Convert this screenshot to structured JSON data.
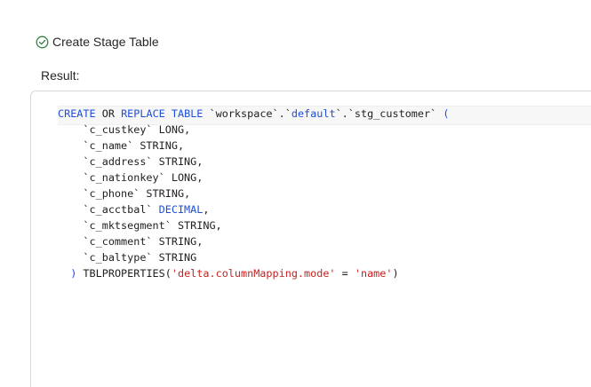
{
  "task": {
    "status_icon": "check-circle-icon",
    "title": "Create Stage Table",
    "status_color": "#2e8540"
  },
  "result": {
    "label": "Result:"
  },
  "code": {
    "lines": [
      [
        {
          "t": "CREATE",
          "c": "kw"
        },
        {
          "t": " ",
          "c": "plain"
        },
        {
          "t": "OR",
          "c": "plain"
        },
        {
          "t": " ",
          "c": "plain"
        },
        {
          "t": "REPLACE",
          "c": "kw"
        },
        {
          "t": " ",
          "c": "plain"
        },
        {
          "t": "TABLE",
          "c": "kw"
        },
        {
          "t": " `workspace`.`",
          "c": "plain"
        },
        {
          "t": "default",
          "c": "kw"
        },
        {
          "t": "`.`stg_customer` ",
          "c": "plain"
        },
        {
          "t": "(",
          "c": "kw"
        }
      ],
      [
        {
          "t": "    `c_custkey` LONG,",
          "c": "plain"
        }
      ],
      [
        {
          "t": "    `c_name` STRING,",
          "c": "plain"
        }
      ],
      [
        {
          "t": "    `c_address` STRING,",
          "c": "plain"
        }
      ],
      [
        {
          "t": "    `c_nationkey` LONG,",
          "c": "plain"
        }
      ],
      [
        {
          "t": "    `c_phone` STRING,",
          "c": "plain"
        }
      ],
      [
        {
          "t": "    `c_acctbal` ",
          "c": "plain"
        },
        {
          "t": "DECIMAL",
          "c": "kw"
        },
        {
          "t": ",",
          "c": "plain"
        }
      ],
      [
        {
          "t": "    `c_mktsegment` STRING,",
          "c": "plain"
        }
      ],
      [
        {
          "t": "    `c_comment` STRING,",
          "c": "plain"
        }
      ],
      [
        {
          "t": "    `c_baltype` STRING",
          "c": "plain"
        }
      ],
      [
        {
          "t": "  ",
          "c": "plain"
        },
        {
          "t": ")",
          "c": "kw"
        },
        {
          "t": " TBLPROPERTIES(",
          "c": "plain"
        },
        {
          "t": "'delta.columnMapping.mode'",
          "c": "str"
        },
        {
          "t": " = ",
          "c": "plain"
        },
        {
          "t": "'name'",
          "c": "str"
        },
        {
          "t": ")",
          "c": "plain"
        }
      ]
    ]
  }
}
